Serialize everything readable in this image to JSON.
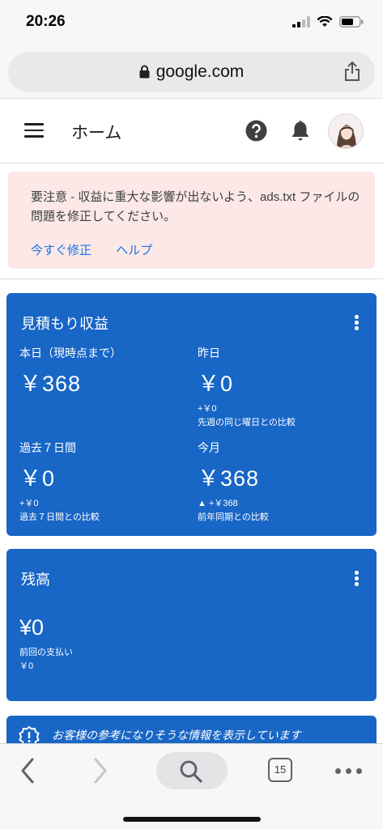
{
  "status_bar": {
    "time": "20:26"
  },
  "browser": {
    "url": "google.com",
    "tab_count": "15"
  },
  "header": {
    "title": "ホーム"
  },
  "warning": {
    "message": "要注意 - 収益に重大な影響が出ないよう、ads.txt ファイルの問題を修正してください。",
    "fix_now_link": "今すぐ修正",
    "help_link": "ヘルプ"
  },
  "earnings_card": {
    "title": "見積もり収益",
    "today": {
      "label": "本日（現時点まで）",
      "value": "￥368"
    },
    "yesterday": {
      "label": "昨日",
      "value": "￥0",
      "change": "+￥0",
      "comparison": "先週の同じ曜日との比較"
    },
    "last7": {
      "label": "過去７日間",
      "value": "￥0",
      "change": "+￥0",
      "comparison": "過去７日間との比較"
    },
    "this_month": {
      "label": "今月",
      "value": "￥368",
      "change": "▲ +￥368",
      "comparison": "前年同期との比較"
    }
  },
  "balance_card": {
    "title": "残高",
    "value": "¥0",
    "last_payment_label": "前回の支払い",
    "last_payment_value": "￥0"
  },
  "info_card": {
    "text": "お客様の参考になりそうな情報を表示しています"
  },
  "colors": {
    "card_blue": "#1866c6",
    "warning_bg": "#fce8e6",
    "link_blue": "#1a73e8"
  }
}
